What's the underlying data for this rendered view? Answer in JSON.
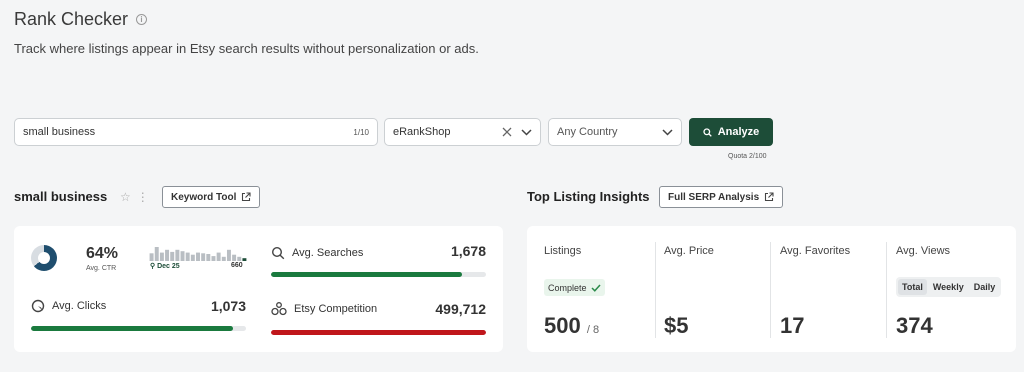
{
  "header": {
    "title": "Rank Checker",
    "info_icon": "i",
    "subtitle": "Track where listings appear in Etsy search results without personalization or ads."
  },
  "search": {
    "keyword_value": "small business",
    "keyword_counter": "1/10",
    "shop_value": "eRankShop",
    "country_value": "Any Country",
    "analyze_label": "Analyze",
    "quota": "Quota 2/100"
  },
  "left_section": {
    "title": "small business",
    "keyword_tool_label": "Keyword Tool",
    "ctr": {
      "value": "64%",
      "label": "Avg. CTR",
      "fraction": 0.64
    },
    "sparkline": {
      "date": "Dec 25",
      "value": "660",
      "bars": [
        0.55,
        1.0,
        0.6,
        0.8,
        0.65,
        0.8,
        0.7,
        0.6,
        0.45,
        0.6,
        0.55,
        0.5,
        0.35,
        0.6,
        0.3,
        0.8,
        0.45,
        0.3,
        0.2
      ]
    },
    "avg_searches": {
      "label": "Avg. Searches",
      "value": "1,678",
      "fill": 0.89,
      "color": "#1a7a3e"
    },
    "avg_clicks": {
      "label": "Avg. Clicks",
      "value": "1,073",
      "fill": 0.94,
      "color": "#1a7a3e"
    },
    "etsy_competition": {
      "label": "Etsy Competition",
      "value": "499,712",
      "fill": 1.0,
      "color": "#c0161b"
    }
  },
  "right_section": {
    "title": "Top Listing Insights",
    "full_serp_label": "Full SERP Analysis",
    "listings": {
      "label": "Listings",
      "badge": "Complete",
      "value": "500",
      "sub": "/ 8"
    },
    "avg_price": {
      "label": "Avg. Price",
      "value": "$5"
    },
    "avg_favorites": {
      "label": "Avg. Favorites",
      "value": "17"
    },
    "avg_views": {
      "label": "Avg. Views",
      "value": "374",
      "tabs": [
        "Total",
        "Weekly",
        "Daily"
      ],
      "active_tab": "Total"
    }
  }
}
